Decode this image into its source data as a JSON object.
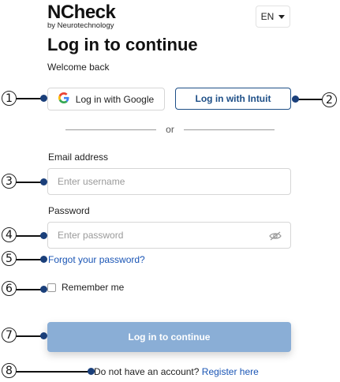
{
  "logo": {
    "main": "NCheck",
    "sub": "by Neurotechnology"
  },
  "language": {
    "selected": "EN"
  },
  "title": "Log in to continue",
  "subtitle": "Welcome back",
  "sso": {
    "google_label": "Log in with Google",
    "intuit_label": "Log in with Intuit"
  },
  "divider_text": "or",
  "email": {
    "label": "Email address",
    "placeholder": "Enter username",
    "value": ""
  },
  "password": {
    "label": "Password",
    "placeholder": "Enter password",
    "value": ""
  },
  "forgot_label": "Forgot your password?",
  "remember_label": "Remember me",
  "remember_checked": false,
  "submit_label": "Log in to continue",
  "register": {
    "prompt": "Do not have an account?",
    "link": "Register here"
  },
  "annotations": [
    "1",
    "2",
    "3",
    "4",
    "5",
    "6",
    "7",
    "8"
  ],
  "colors": {
    "primary": "#1e4f87",
    "link": "#1a55b5",
    "submit_disabled": "#8aaed6",
    "annotation_dot": "#1a3f7a"
  }
}
